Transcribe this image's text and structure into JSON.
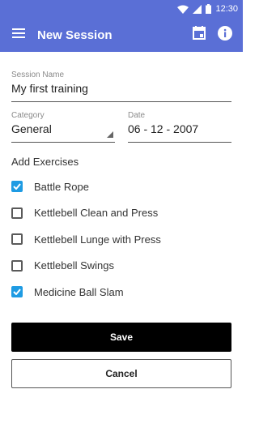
{
  "status_bar": {
    "time": "12:30"
  },
  "app_bar": {
    "title": "New Session"
  },
  "form": {
    "session_name": {
      "label": "Session Name",
      "value": "My first training"
    },
    "category": {
      "label": "Category",
      "value": "General"
    },
    "date": {
      "label": "Date",
      "value": "06 - 12 - 2007"
    }
  },
  "exercises": {
    "title": "Add Exercises",
    "items": [
      {
        "label": "Battle Rope",
        "checked": true
      },
      {
        "label": "Kettlebell Clean and Press",
        "checked": false
      },
      {
        "label": "Kettlebell Lunge with Press",
        "checked": false
      },
      {
        "label": "Kettlebell Swings",
        "checked": false
      },
      {
        "label": "Medicine Ball Slam",
        "checked": true
      }
    ]
  },
  "buttons": {
    "save_label": "Save",
    "cancel_label": "Cancel"
  },
  "colors": {
    "primary": "#5a6fd6",
    "checkbox_checked": "#1e9be3",
    "save_button": "#000000"
  }
}
